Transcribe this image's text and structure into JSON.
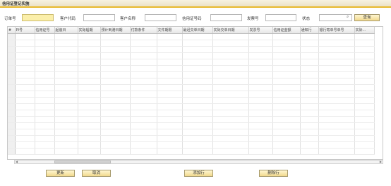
{
  "window": {
    "title": "信用证登记实施"
  },
  "form": {
    "order_no_label": "订单号",
    "order_no_value": "",
    "customer_code_label": "客户代码",
    "customer_code_value": "",
    "customer_name_label": "客户名称",
    "customer_name_value": "",
    "lc_no_label": "信用证号码",
    "lc_no_value": "",
    "invoice_no_label": "发票号",
    "invoice_no_value": "",
    "status_label": "状态",
    "status_value": "",
    "query_button": "查询"
  },
  "grid": {
    "columns": [
      "#",
      "PI号",
      "信用证号",
      "起装日",
      "实际船期",
      "预计到港日期",
      "付款条件",
      "文件期限",
      "最迟交单日期",
      "实际交单日期",
      "发票号",
      "信用证金额",
      "通知行",
      "银行寄单号单号",
      "实际..."
    ],
    "column_widths": [
      10,
      28,
      28,
      33,
      32,
      42,
      38,
      36,
      43,
      51,
      34,
      39,
      26,
      51,
      28
    ],
    "row_count": 19
  },
  "footer": {
    "update_button": "更新",
    "cancel_button": "取消",
    "add_row_button": "添加行",
    "delete_row_button": "删除行"
  }
}
